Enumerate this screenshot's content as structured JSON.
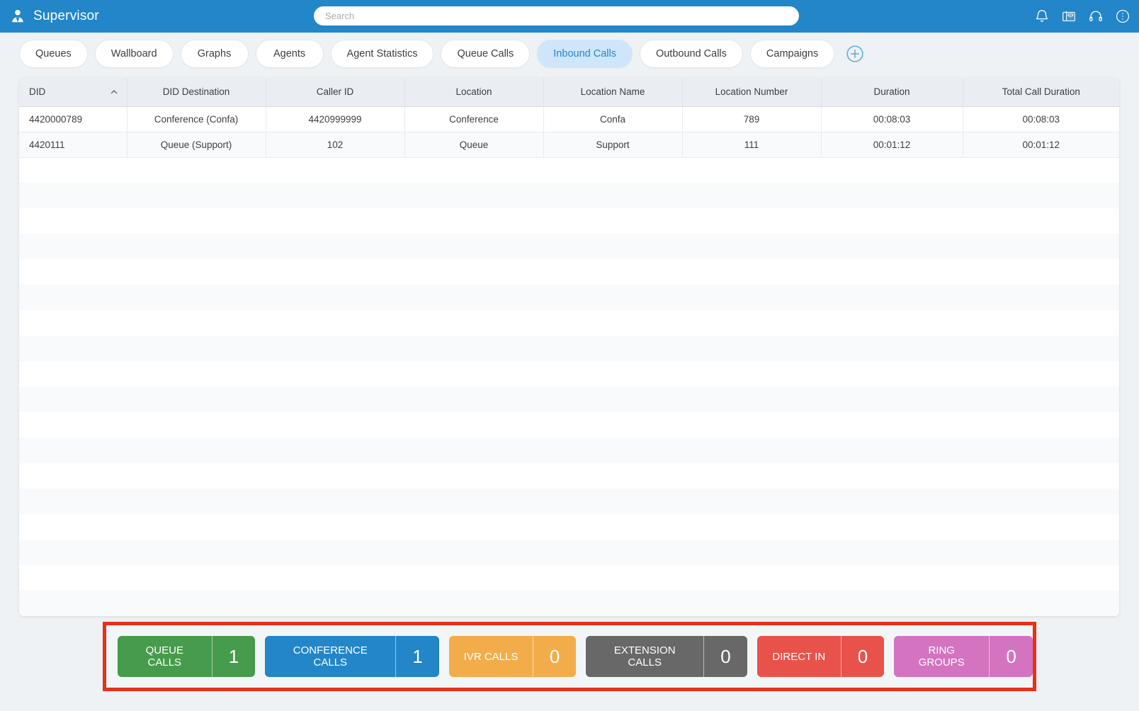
{
  "topbar": {
    "brand_title": "Supervisor",
    "brand_icon": "user-supervisor-icon",
    "search_placeholder": "Search",
    "search_value": "",
    "icons": [
      {
        "name": "bell-icon"
      },
      {
        "name": "desk-phone-icon"
      },
      {
        "name": "headset-icon"
      },
      {
        "name": "more-options-icon"
      }
    ],
    "accent_color": "#2286c9"
  },
  "tabs": {
    "items": [
      {
        "label": "Queues",
        "active": false
      },
      {
        "label": "Wallboard",
        "active": false
      },
      {
        "label": "Graphs",
        "active": false
      },
      {
        "label": "Agents",
        "active": false
      },
      {
        "label": "Agent Statistics",
        "active": false
      },
      {
        "label": "Queue Calls",
        "active": false
      },
      {
        "label": "Inbound Calls",
        "active": true
      },
      {
        "label": "Outbound Calls",
        "active": false
      },
      {
        "label": "Campaigns",
        "active": false
      }
    ],
    "add_icon": "add-tab-icon",
    "active_bg": "#cfe6fa",
    "active_color": "#2286c9"
  },
  "table": {
    "sort_column": "DID",
    "sort_direction": "asc",
    "columns": [
      "DID",
      "DID Destination",
      "Caller ID",
      "Location",
      "Location Name",
      "Location Number",
      "Duration",
      "Total Call Duration"
    ],
    "rows": [
      {
        "did": "4420000789",
        "did_destination": "Conference (Confa)",
        "caller_id": "4420999999",
        "location": "Conference",
        "location_name": "Confa",
        "location_number": "789",
        "duration": "00:08:03",
        "total_call_duration": "00:08:03"
      },
      {
        "did": "4420111",
        "did_destination": "Queue (Support)",
        "caller_id": "102",
        "location": "Queue",
        "location_name": "Support",
        "location_number": "111",
        "duration": "00:01:12",
        "total_call_duration": "00:01:12"
      }
    ]
  },
  "summary": {
    "highlight_color": "#e8301b",
    "badges": [
      {
        "label": "QUEUE CALLS",
        "value": "1",
        "color": "#469b4c"
      },
      {
        "label": "CONFERENCE CALLS",
        "value": "1",
        "color": "#2286c9"
      },
      {
        "label": "IVR CALLS",
        "value": "0",
        "color": "#f2ad4a"
      },
      {
        "label": "EXTENSION CALLS",
        "value": "0",
        "color": "#686868"
      },
      {
        "label": "DIRECT IN",
        "value": "0",
        "color": "#e9524b"
      },
      {
        "label": "RING GROUPS",
        "value": "0",
        "color": "#d473c0"
      }
    ]
  }
}
